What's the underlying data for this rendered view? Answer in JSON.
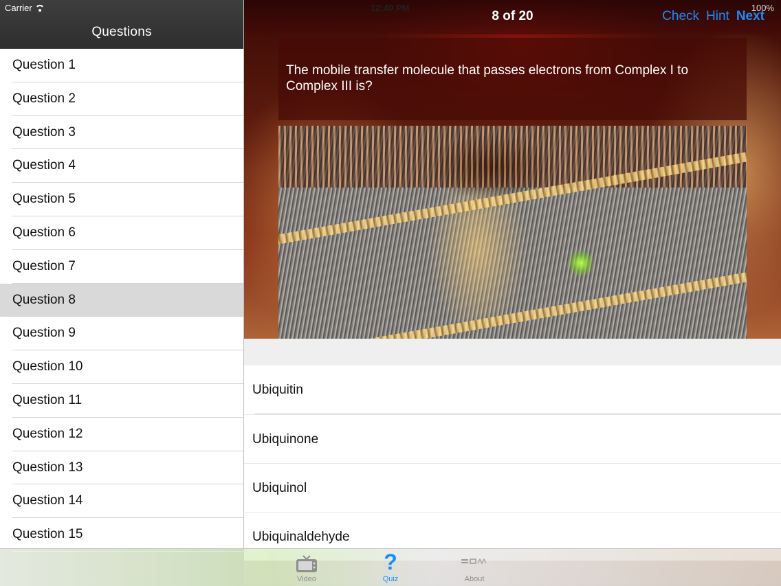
{
  "status_bar": {
    "carrier": "Carrier",
    "time": "12:40 PM",
    "battery": "100%"
  },
  "sidebar": {
    "title": "Questions",
    "items": [
      {
        "label": "Question 1"
      },
      {
        "label": "Question 2"
      },
      {
        "label": "Question 3"
      },
      {
        "label": "Question 4"
      },
      {
        "label": "Question 5"
      },
      {
        "label": "Question 6"
      },
      {
        "label": "Question 7"
      },
      {
        "label": "Question 8",
        "selected": true
      },
      {
        "label": "Question 9"
      },
      {
        "label": "Question 10"
      },
      {
        "label": "Question 11"
      },
      {
        "label": "Question 12"
      },
      {
        "label": "Question 13"
      },
      {
        "label": "Question 14"
      },
      {
        "label": "Question 15"
      }
    ]
  },
  "navbar": {
    "counter": "8 of 20",
    "check_label": "Check",
    "hint_label": "Hint",
    "next_label": "Next",
    "accent_color": "#1a8cff"
  },
  "question": {
    "text": "The mobile transfer molecule that passes electrons from Complex I to Complex III is?",
    "image_icon": "electron-transport-illustration"
  },
  "answers": [
    {
      "label": "Ubiquitin"
    },
    {
      "label": "Ubiquinone"
    },
    {
      "label": "Ubiquinol"
    },
    {
      "label": "Ubiquinaldehyde"
    }
  ],
  "tabbar": {
    "tabs": [
      {
        "label": "Video",
        "icon": "tv-icon",
        "active": false
      },
      {
        "label": "Quiz",
        "icon": "question-mark-icon",
        "active": true
      },
      {
        "label": "About",
        "icon": "3dme-logo-icon",
        "active": false
      }
    ]
  }
}
